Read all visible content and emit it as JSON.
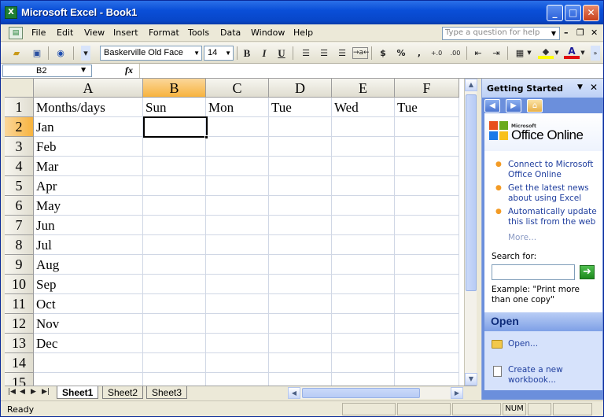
{
  "window": {
    "title": "Microsoft Excel - Book1",
    "minimize": "_",
    "maximize": "□",
    "close": "✕"
  },
  "menu": {
    "items": [
      "File",
      "Edit",
      "View",
      "Insert",
      "Format",
      "Tools",
      "Data",
      "Window",
      "Help"
    ],
    "ask_placeholder": "Type a question for help",
    "doc_minimize": "–",
    "doc_restore": "❐",
    "doc_close": "✕"
  },
  "toolbar": {
    "font": "Baskerville Old Face",
    "size": "14",
    "bold": "B",
    "italic": "I",
    "underline": "U",
    "currency": "$",
    "percent": "%",
    "comma": ",",
    "inc_decimal": "+.0",
    "dec_decimal": ".00"
  },
  "formula_bar": {
    "name_box": "B2",
    "fx": "fx",
    "content": ""
  },
  "grid": {
    "columns": [
      "A",
      "B",
      "C",
      "D",
      "E",
      "F"
    ],
    "rows": [
      "1",
      "2",
      "3",
      "4",
      "5",
      "6",
      "7",
      "8",
      "9",
      "10",
      "11",
      "12",
      "13",
      "14",
      "15"
    ],
    "cells": [
      [
        "Months/days",
        "Sun",
        "Mon",
        "Tue",
        "Wed",
        "Tue"
      ],
      [
        "Jan",
        "",
        "",
        "",
        "",
        ""
      ],
      [
        "Feb",
        "",
        "",
        "",
        "",
        ""
      ],
      [
        "Mar",
        "",
        "",
        "",
        "",
        ""
      ],
      [
        "Apr",
        "",
        "",
        "",
        "",
        ""
      ],
      [
        "May",
        "",
        "",
        "",
        "",
        ""
      ],
      [
        "Jun",
        "",
        "",
        "",
        "",
        ""
      ],
      [
        "Jul",
        "",
        "",
        "",
        "",
        ""
      ],
      [
        "Aug",
        "",
        "",
        "",
        "",
        ""
      ],
      [
        "Sep",
        "",
        "",
        "",
        "",
        ""
      ],
      [
        "Oct",
        "",
        "",
        "",
        "",
        ""
      ],
      [
        "Nov",
        "",
        "",
        "",
        "",
        ""
      ],
      [
        "Dec",
        "",
        "",
        "",
        "",
        ""
      ],
      [
        "",
        "",
        "",
        "",
        "",
        ""
      ],
      [
        "",
        "",
        "",
        "",
        "",
        ""
      ]
    ],
    "selected_cell": "B2",
    "selected_column": "B",
    "selected_row": "2"
  },
  "sheets": {
    "tabs": [
      "Sheet1",
      "Sheet2",
      "Sheet3"
    ],
    "active": "Sheet1"
  },
  "status": {
    "text": "Ready",
    "num": "NUM"
  },
  "task_pane": {
    "title": "Getting Started",
    "logo_small": "Microsoft",
    "logo_text": "Office Online",
    "links": [
      "Connect to Microsoft Office Online",
      "Get the latest news about using Excel",
      "Automatically update this list from the web"
    ],
    "more": "More...",
    "search_label": "Search for:",
    "search_value": "",
    "example": "Example:  \"Print more than one copy\"",
    "open_header": "Open",
    "open_link": "Open...",
    "create_link": "Create a new workbook..."
  }
}
